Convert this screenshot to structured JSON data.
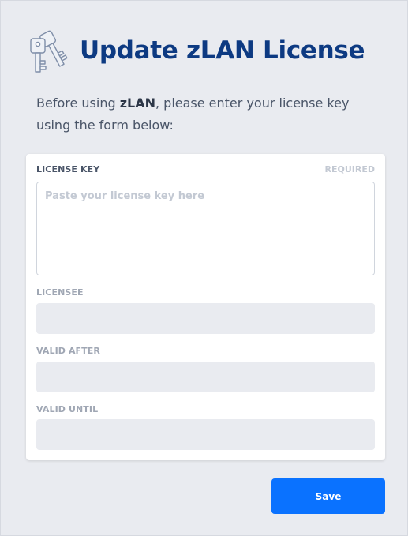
{
  "header": {
    "title": "Update zLAN License",
    "logo_icon": "keys-icon"
  },
  "intro": {
    "text_before": "Before using ",
    "app_name": "zLAN",
    "text_after": ", please enter your license key using the form below:"
  },
  "form": {
    "license_key": {
      "label": "LICENSE KEY",
      "required_label": "REQUIRED",
      "placeholder": "Paste your license key here",
      "value": ""
    },
    "licensee": {
      "label": "LICENSEE",
      "value": ""
    },
    "valid_after": {
      "label": "VALID AFTER",
      "value": ""
    },
    "valid_until": {
      "label": "VALID UNTIL",
      "value": ""
    }
  },
  "actions": {
    "save_label": "Save"
  },
  "colors": {
    "background": "#e9ebf0",
    "title": "#0d3a82",
    "accent": "#0a72ff",
    "card": "#ffffff"
  }
}
